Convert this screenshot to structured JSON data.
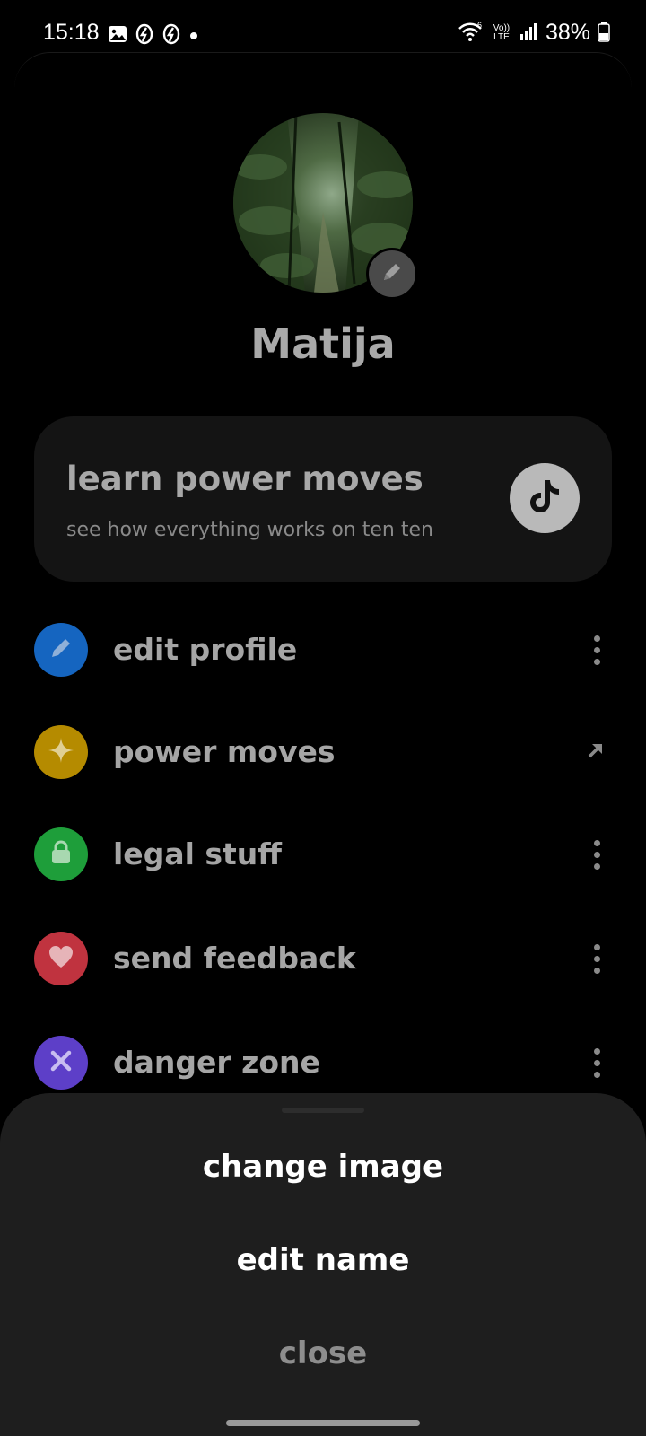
{
  "status_bar": {
    "time": "15:18",
    "battery_text": "38%",
    "icons_left": [
      "gallery-icon",
      "app-notification-icon",
      "app-notification-icon",
      "dot-icon"
    ],
    "icons_right": [
      "wifi-icon",
      "volte-icon",
      "signal-icon",
      "battery-icon"
    ],
    "volte_label": "Vo)) LTE",
    "wifi_badge": "6"
  },
  "profile": {
    "name": "Matija",
    "avatar_icon": "forest-photo",
    "edit_icon": "pencil-icon"
  },
  "learn_card": {
    "title": "learn power moves",
    "subtitle": "see how everything works on ten ten",
    "icon": "tiktok-icon"
  },
  "menu": {
    "items": [
      {
        "label": "edit profile",
        "icon": "pencil-icon",
        "color": "#1565c0",
        "trailing": "more-icon"
      },
      {
        "label": "power moves",
        "icon": "sparkle-icon",
        "color": "#b58b00",
        "trailing": "external-arrow-icon"
      },
      {
        "label": "legal stuff",
        "icon": "lock-icon",
        "color": "#1e9e3a",
        "trailing": "more-icon"
      },
      {
        "label": "send feedback",
        "icon": "heart-icon",
        "color": "#c0333f",
        "trailing": "more-icon"
      },
      {
        "label": "danger zone",
        "icon": "close-icon",
        "color": "#5d3fc8",
        "trailing": "more-icon"
      }
    ]
  },
  "bottom_sheet": {
    "change_image": "change image",
    "edit_name": "edit name",
    "close": "close"
  }
}
